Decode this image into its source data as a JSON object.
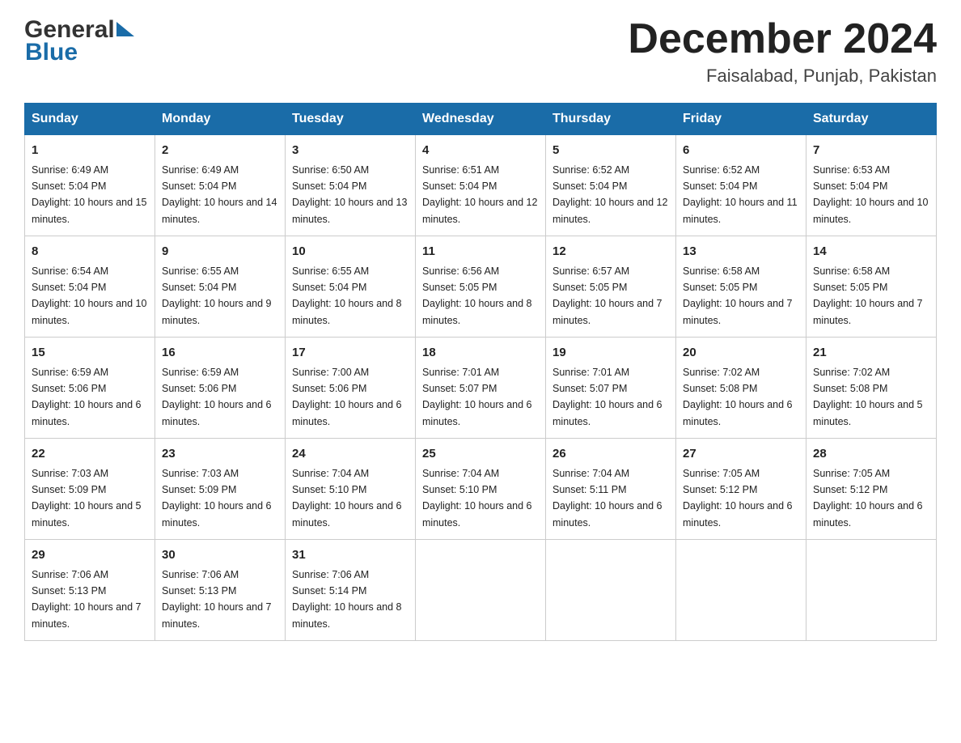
{
  "header": {
    "logo_general": "General",
    "logo_blue": "Blue",
    "month_title": "December 2024",
    "location": "Faisalabad, Punjab, Pakistan"
  },
  "days_of_week": [
    "Sunday",
    "Monday",
    "Tuesday",
    "Wednesday",
    "Thursday",
    "Friday",
    "Saturday"
  ],
  "weeks": [
    [
      {
        "day": "1",
        "sunrise": "6:49 AM",
        "sunset": "5:04 PM",
        "daylight": "10 hours and 15 minutes."
      },
      {
        "day": "2",
        "sunrise": "6:49 AM",
        "sunset": "5:04 PM",
        "daylight": "10 hours and 14 minutes."
      },
      {
        "day": "3",
        "sunrise": "6:50 AM",
        "sunset": "5:04 PM",
        "daylight": "10 hours and 13 minutes."
      },
      {
        "day": "4",
        "sunrise": "6:51 AM",
        "sunset": "5:04 PM",
        "daylight": "10 hours and 12 minutes."
      },
      {
        "day": "5",
        "sunrise": "6:52 AM",
        "sunset": "5:04 PM",
        "daylight": "10 hours and 12 minutes."
      },
      {
        "day": "6",
        "sunrise": "6:52 AM",
        "sunset": "5:04 PM",
        "daylight": "10 hours and 11 minutes."
      },
      {
        "day": "7",
        "sunrise": "6:53 AM",
        "sunset": "5:04 PM",
        "daylight": "10 hours and 10 minutes."
      }
    ],
    [
      {
        "day": "8",
        "sunrise": "6:54 AM",
        "sunset": "5:04 PM",
        "daylight": "10 hours and 10 minutes."
      },
      {
        "day": "9",
        "sunrise": "6:55 AM",
        "sunset": "5:04 PM",
        "daylight": "10 hours and 9 minutes."
      },
      {
        "day": "10",
        "sunrise": "6:55 AM",
        "sunset": "5:04 PM",
        "daylight": "10 hours and 8 minutes."
      },
      {
        "day": "11",
        "sunrise": "6:56 AM",
        "sunset": "5:05 PM",
        "daylight": "10 hours and 8 minutes."
      },
      {
        "day": "12",
        "sunrise": "6:57 AM",
        "sunset": "5:05 PM",
        "daylight": "10 hours and 7 minutes."
      },
      {
        "day": "13",
        "sunrise": "6:58 AM",
        "sunset": "5:05 PM",
        "daylight": "10 hours and 7 minutes."
      },
      {
        "day": "14",
        "sunrise": "6:58 AM",
        "sunset": "5:05 PM",
        "daylight": "10 hours and 7 minutes."
      }
    ],
    [
      {
        "day": "15",
        "sunrise": "6:59 AM",
        "sunset": "5:06 PM",
        "daylight": "10 hours and 6 minutes."
      },
      {
        "day": "16",
        "sunrise": "6:59 AM",
        "sunset": "5:06 PM",
        "daylight": "10 hours and 6 minutes."
      },
      {
        "day": "17",
        "sunrise": "7:00 AM",
        "sunset": "5:06 PM",
        "daylight": "10 hours and 6 minutes."
      },
      {
        "day": "18",
        "sunrise": "7:01 AM",
        "sunset": "5:07 PM",
        "daylight": "10 hours and 6 minutes."
      },
      {
        "day": "19",
        "sunrise": "7:01 AM",
        "sunset": "5:07 PM",
        "daylight": "10 hours and 6 minutes."
      },
      {
        "day": "20",
        "sunrise": "7:02 AM",
        "sunset": "5:08 PM",
        "daylight": "10 hours and 6 minutes."
      },
      {
        "day": "21",
        "sunrise": "7:02 AM",
        "sunset": "5:08 PM",
        "daylight": "10 hours and 5 minutes."
      }
    ],
    [
      {
        "day": "22",
        "sunrise": "7:03 AM",
        "sunset": "5:09 PM",
        "daylight": "10 hours and 5 minutes."
      },
      {
        "day": "23",
        "sunrise": "7:03 AM",
        "sunset": "5:09 PM",
        "daylight": "10 hours and 6 minutes."
      },
      {
        "day": "24",
        "sunrise": "7:04 AM",
        "sunset": "5:10 PM",
        "daylight": "10 hours and 6 minutes."
      },
      {
        "day": "25",
        "sunrise": "7:04 AM",
        "sunset": "5:10 PM",
        "daylight": "10 hours and 6 minutes."
      },
      {
        "day": "26",
        "sunrise": "7:04 AM",
        "sunset": "5:11 PM",
        "daylight": "10 hours and 6 minutes."
      },
      {
        "day": "27",
        "sunrise": "7:05 AM",
        "sunset": "5:12 PM",
        "daylight": "10 hours and 6 minutes."
      },
      {
        "day": "28",
        "sunrise": "7:05 AM",
        "sunset": "5:12 PM",
        "daylight": "10 hours and 6 minutes."
      }
    ],
    [
      {
        "day": "29",
        "sunrise": "7:06 AM",
        "sunset": "5:13 PM",
        "daylight": "10 hours and 7 minutes."
      },
      {
        "day": "30",
        "sunrise": "7:06 AM",
        "sunset": "5:13 PM",
        "daylight": "10 hours and 7 minutes."
      },
      {
        "day": "31",
        "sunrise": "7:06 AM",
        "sunset": "5:14 PM",
        "daylight": "10 hours and 8 minutes."
      },
      null,
      null,
      null,
      null
    ]
  ],
  "labels": {
    "sunrise": "Sunrise: ",
    "sunset": "Sunset: ",
    "daylight": "Daylight: "
  }
}
